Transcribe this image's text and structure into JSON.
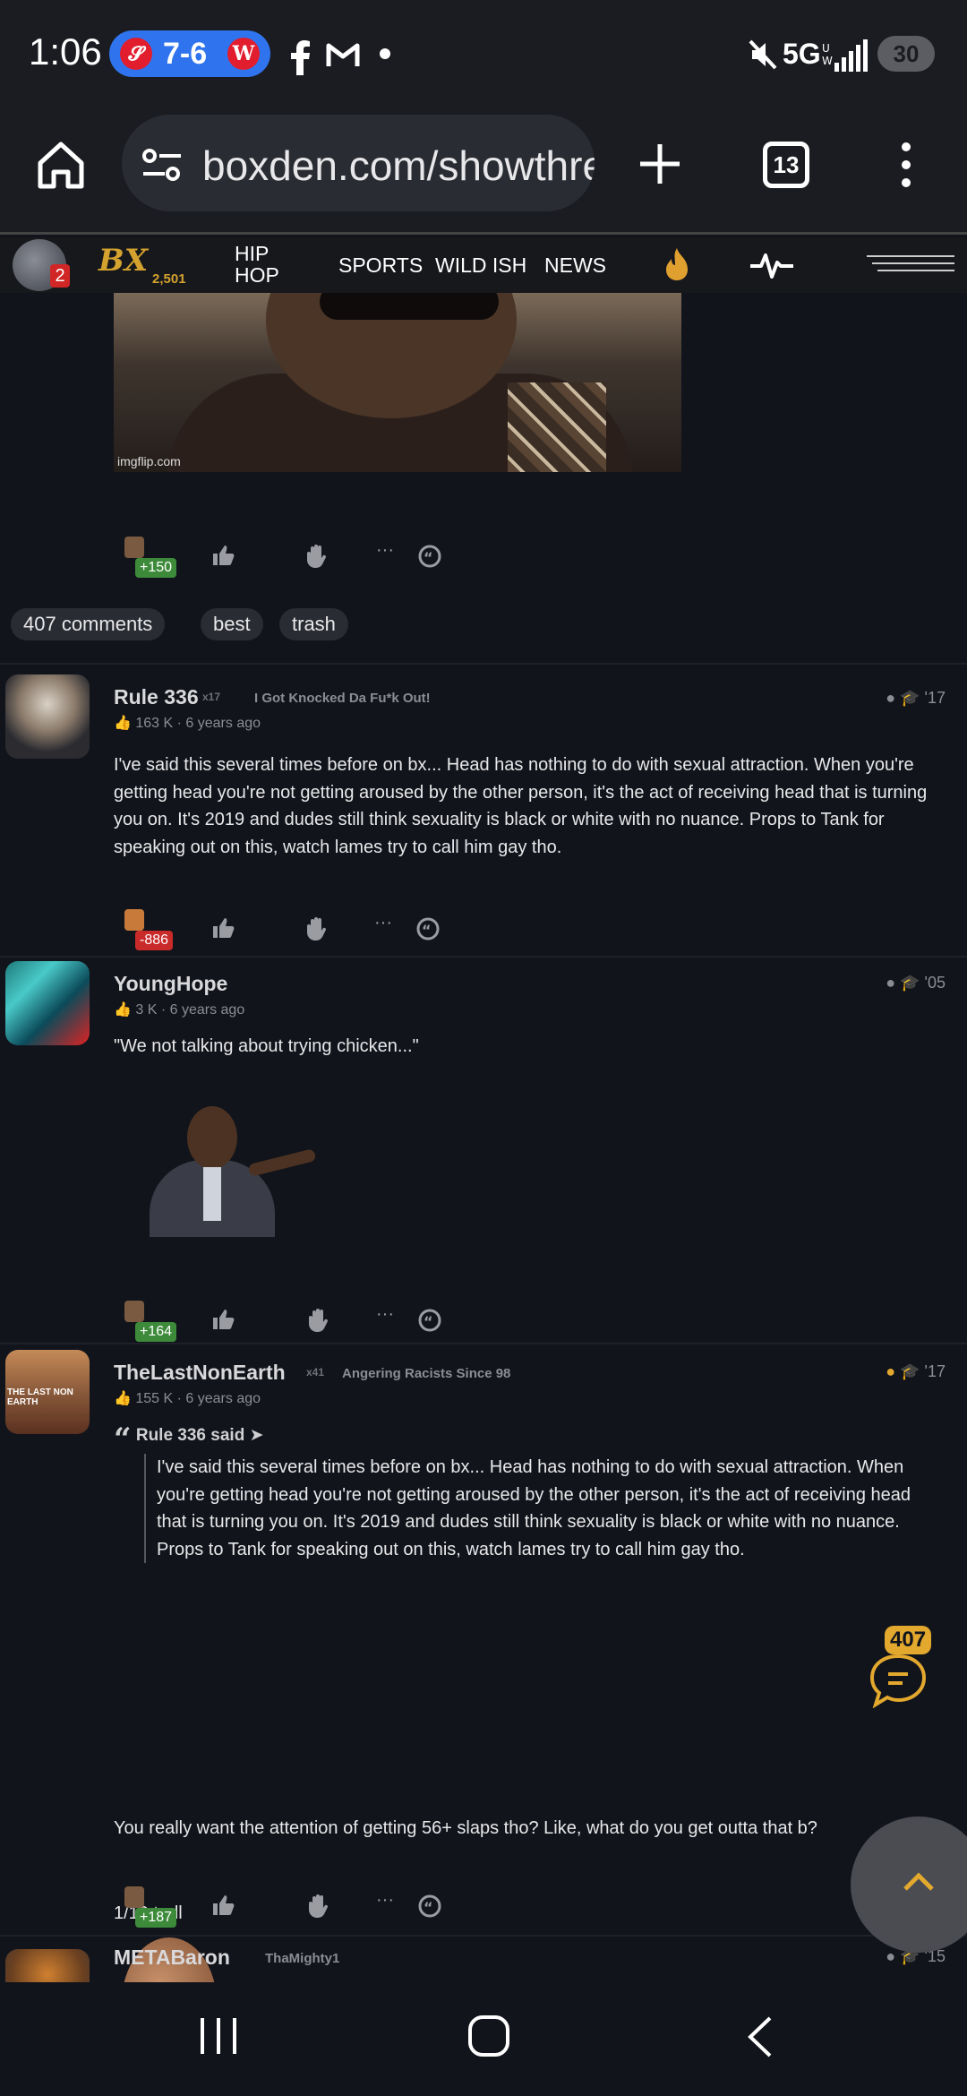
{
  "status_bar": {
    "time": "1:06",
    "score": "7-6",
    "network": "5G",
    "battery": "30",
    "icons": [
      "stl-cardinals-logo",
      "wsh-nationals-logo",
      "facebook-icon",
      "gmail-icon",
      "dot-icon",
      "mute-icon",
      "signal-icon"
    ]
  },
  "browser": {
    "url": "boxden.com/showthread",
    "tab_count": "13"
  },
  "site_nav": {
    "notification_count": "2",
    "logo": "BX",
    "logo_count": "2,501",
    "links": [
      "HIP HOP",
      "SPORTS",
      "WILD ISH",
      "NEWS"
    ]
  },
  "top_post": {
    "image_watermark": "imgflip.com",
    "score": "+150"
  },
  "filters": {
    "comments": "407 comments",
    "best": "best",
    "trash": "trash"
  },
  "posts": [
    {
      "username": "Rule 336",
      "flair": "x17",
      "tagline": "I Got Knocked Da Fu*k Out!",
      "likes": "163 K",
      "age": "6 years ago",
      "year": "'17",
      "text": "I've said this several times before on bx... Head has nothing to do with sexual attraction. When you're getting head you're not getting aroused by the other person, it's the act of receiving head that is turning you on. It's 2019 and dudes still think sexuality is black or white with no nuance. Props to Tank for speaking out on this, watch lames try to call him gay tho.",
      "score": "-886"
    },
    {
      "username": "YoungHope",
      "likes": "3 K",
      "age": "6 years ago",
      "year": "'05",
      "text": "\"We not talking about trying chicken...\"",
      "score": "+164"
    },
    {
      "username": "TheLastNonEarth",
      "flair": "x41",
      "tagline": "Angering Racists Since 98",
      "likes": "155 K",
      "age": "6 years ago",
      "year": "'17",
      "quote_author": "Rule 336 said ➤",
      "quote_text": "I've said this several times before on bx... Head has nothing to do with sexual attraction. When you're getting head you're not getting aroused by the other person, it's the act of receiving head that is turning you on. It's 2019 and dudes still think sexuality is black or white with no nuance. Props to Tank for speaking out on this, watch lames try to call him gay tho.",
      "text1": "1/10 troll",
      "text2": "You really want the attention of getting 56+ slaps tho? Like, what do you get outta that b?",
      "score": "+187",
      "avatar_text": "THE LAST NON EARTH"
    },
    {
      "username": "METABaron",
      "tagline": "ThaMighty1",
      "year": "'15"
    }
  ],
  "chat_fab": {
    "count": "407"
  },
  "colors": {
    "background": "#11141b",
    "accent_gold": "#d4a22e",
    "positive": "#3d8b3a",
    "negative": "#c92a2a",
    "chrome_blue": "#2f74ee"
  }
}
